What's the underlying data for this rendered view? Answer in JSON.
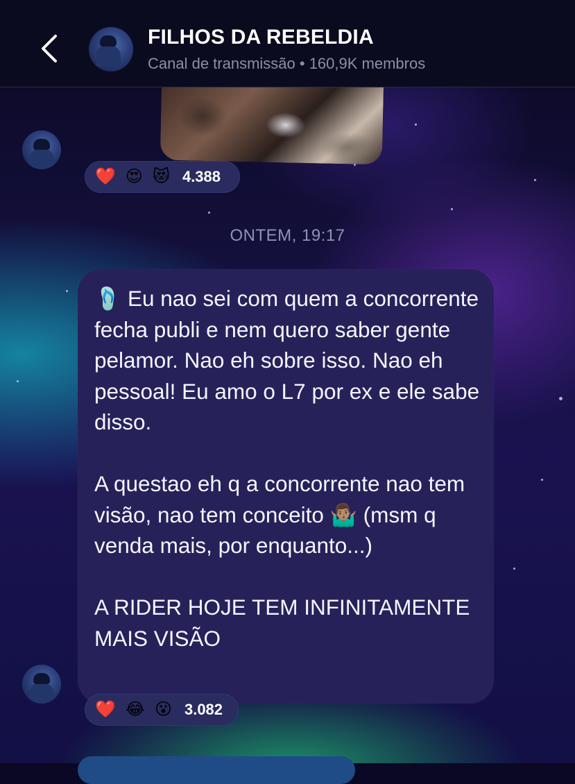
{
  "header": {
    "back_label": "",
    "title": "FILHOS DA REBELDIA",
    "subtitle": "Canal de transmissão  •  160,9K membros"
  },
  "messages": [
    {
      "reactions": {
        "emojis": [
          "❤️",
          "😍",
          "😻"
        ],
        "count": "4.388"
      }
    },
    {
      "date": "ONTEM, 19:17",
      "text": "🩴 Eu nao sei com quem a concorrente fecha publi e nem quero saber gente pelamor. Nao eh sobre isso. Nao eh pessoal! Eu amo o L7 por ex e ele sabe disso.\n\nA questao eh q a concorrente nao tem visão, nao tem conceito 🤷🏽‍♂️ (msm q venda mais, por enquanto...)\n\nA RIDER HOJE TEM INFINITAMENTE MAIS VISÃO",
      "reactions": {
        "emojis": [
          "❤️",
          "😂",
          "😮"
        ],
        "count": "3.082"
      }
    }
  ],
  "colors": {
    "header_bg": "#0b0b1f",
    "bubble_bg": "#262259",
    "reaction_bg": "#2a2b5e",
    "text": "#f5f5ff",
    "muted": "#8c8fa8"
  },
  "icons": [
    "chevron-left-icon"
  ]
}
